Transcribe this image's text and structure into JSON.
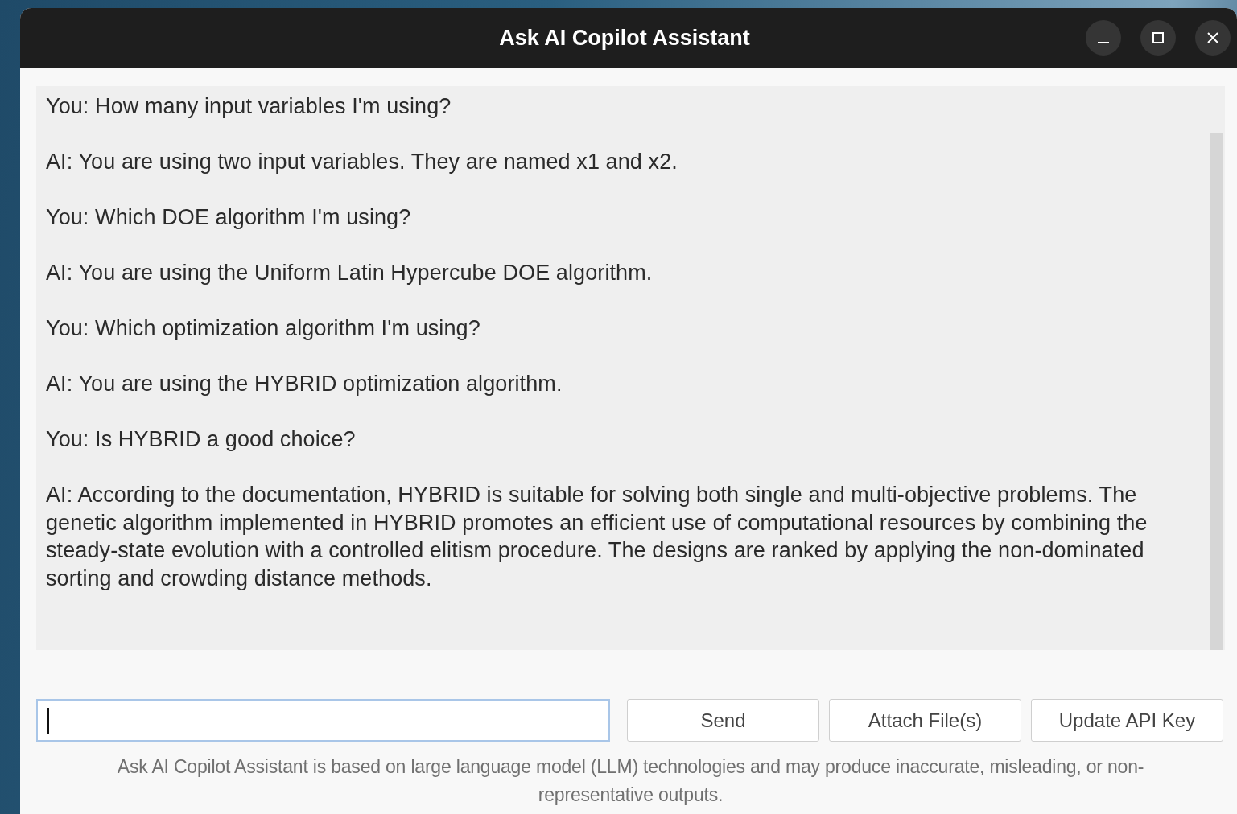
{
  "window": {
    "title": "Ask AI Copilot Assistant"
  },
  "messages": [
    "You: How many input variables I'm using?",
    "AI: You are using two input variables. They are named x1 and x2.",
    "You: Which DOE algorithm I'm using?",
    "AI: You are using the Uniform Latin Hypercube DOE algorithm.",
    "You: Which optimization algorithm I'm using?",
    "AI: You are using the HYBRID optimization algorithm.",
    "You: Is HYBRID a good choice?",
    "AI: According to the documentation, HYBRID is suitable for solving both single and multi-objective problems. The genetic algorithm implemented in HYBRID promotes an efficient use of computational resources by combining the steady-state evolution with a controlled elitism procedure. The designs are ranked by applying the non-dominated sorting and crowding distance methods."
  ],
  "input": {
    "focused": true
  },
  "buttons": [
    "Send",
    "Attach File(s)",
    "Update API Key"
  ],
  "disclaimer": "Ask AI Copilot Assistant is based on large language model (LLM) technologies and may produce inaccurate, misleading, or non-representative outputs."
}
